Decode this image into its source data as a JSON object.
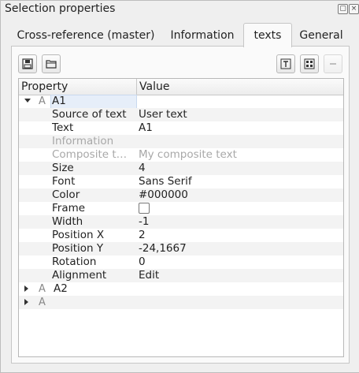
{
  "window": {
    "title": "Selection properties",
    "float_icon": "float-icon",
    "close_icon": "close-icon"
  },
  "tabs": [
    {
      "label": "Cross-reference (master)"
    },
    {
      "label": "Information"
    },
    {
      "label": "texts",
      "active": true
    },
    {
      "label": "General"
    }
  ],
  "toolbar": {
    "left": [
      "save-icon",
      "open-folder-icon"
    ],
    "right": [
      "text-add-icon",
      "grid-icon",
      "minus-icon"
    ]
  },
  "table": {
    "headers": {
      "property": "Property",
      "value": "Value"
    },
    "group_a1": {
      "name": "A1",
      "type_glyph": "A"
    },
    "rows": [
      {
        "name": "Source of text",
        "value": "User text"
      },
      {
        "name": "Text",
        "value": "A1"
      },
      {
        "name": "Information",
        "value": ""
      },
      {
        "name": "Composite t…",
        "value": "My composite text"
      },
      {
        "name": "Size",
        "value": "4"
      },
      {
        "name": "Font",
        "value": "Sans Serif"
      },
      {
        "name": "Color",
        "value": "#000000"
      },
      {
        "name": "Frame",
        "value": ""
      },
      {
        "name": "Width",
        "value": "-1"
      },
      {
        "name": "Position X",
        "value": "2"
      },
      {
        "name": "Position Y",
        "value": "-24,1667"
      },
      {
        "name": "Rotation",
        "value": "0"
      },
      {
        "name": "Alignment",
        "value": "Edit"
      }
    ],
    "group_a2": {
      "name": "A2",
      "type_glyph": "A"
    },
    "group_a3": {
      "name": "",
      "type_glyph": "A"
    }
  }
}
